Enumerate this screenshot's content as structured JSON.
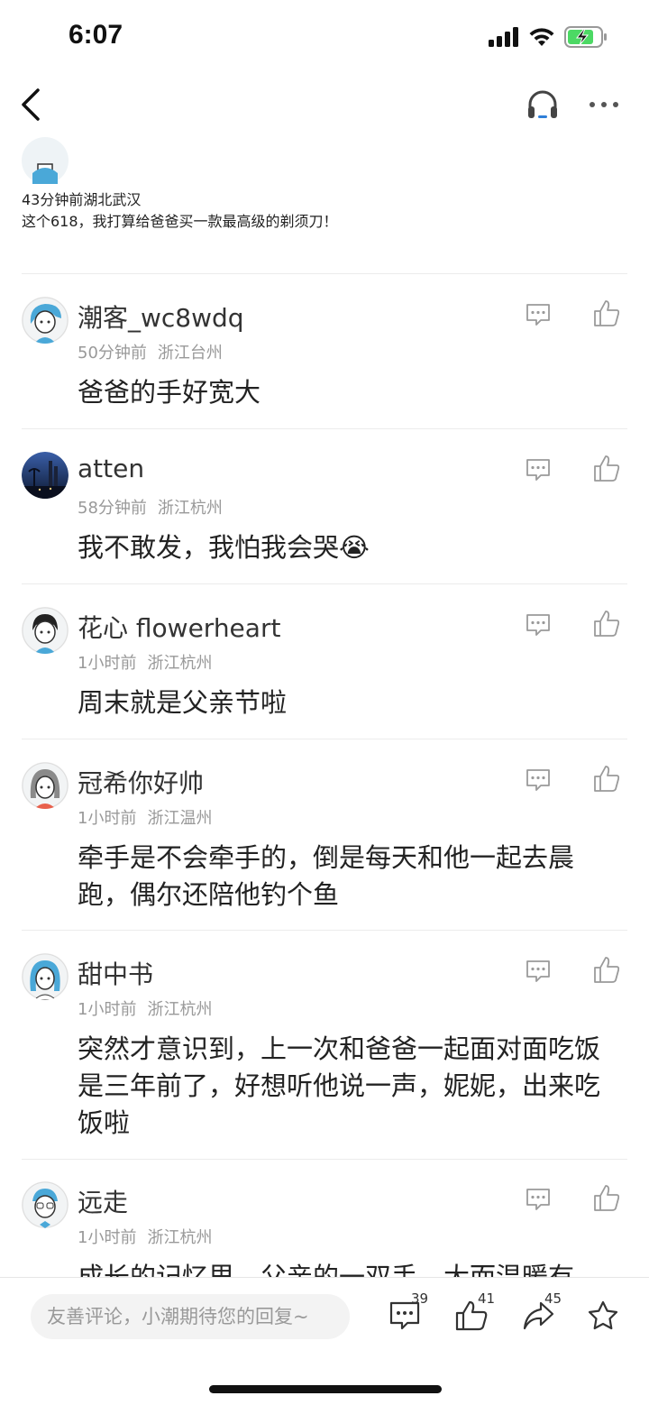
{
  "status_bar": {
    "time": "6:07",
    "battery_color": "#4cd964"
  },
  "nav": {
    "back_icon": "chevron-left-icon",
    "headphone_icon": "headphone-icon",
    "more_icon": "more-dots-icon"
  },
  "first_comment": {
    "time": "43分钟前",
    "location": "湖北武汉",
    "text": "这个618，我打算给爸爸买一款最高级的剃须刀！"
  },
  "comments": [
    {
      "username": "潮客_wc8wdq",
      "time": "50分钟前",
      "location": "浙江台州",
      "text": "爸爸的手好宽大"
    },
    {
      "username": "atten",
      "time": "58分钟前",
      "location": "浙江杭州",
      "text": "我不敢发，我怕我会哭😭"
    },
    {
      "username": "花心 flowerheart",
      "time": "1小时前",
      "location": "浙江杭州",
      "text": "周末就是父亲节啦"
    },
    {
      "username": "冠希你好帅",
      "time": "1小时前",
      "location": "浙江温州",
      "text": "牵手是不会牵手的，倒是每天和他一起去晨跑，偶尔还陪他钓个鱼"
    },
    {
      "username": "甜中书",
      "time": "1小时前",
      "location": "浙江杭州",
      "text": "突然才意识到，上一次和爸爸一起面对面吃饭是三年前了，好想听他说一声，妮妮，出来吃饭啦"
    },
    {
      "username": "远走",
      "time": "1小时前",
      "location": "浙江杭州",
      "text": "成长的记忆里，父亲的一双手，大而温暖有"
    }
  ],
  "bottom_bar": {
    "input_placeholder": "友善评论，小潮期待您的回复~",
    "comment_count": "39",
    "like_count": "41",
    "share_count": "45"
  },
  "colors": {
    "icon_gray": "#9a9a9a",
    "avatar_blue": "#4aa8d8"
  }
}
